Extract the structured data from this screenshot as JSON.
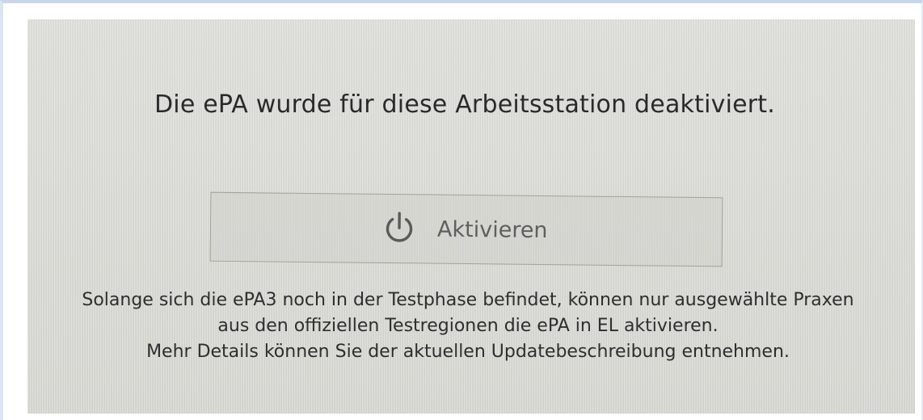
{
  "main": {
    "headline": "Die ePA wurde für diese Arbeitsstation deaktiviert.",
    "activate_button": {
      "label": "Aktivieren",
      "icon": "power-icon"
    },
    "info_lines": [
      "Solange sich die ePA3 noch in der Testphase befindet, können nur ausgewählte Praxen",
      "aus den offiziellen Testregionen die ePA in EL aktivieren.",
      "Mehr Details können Sie der aktuellen Updatebeschreibung entnehmen."
    ]
  }
}
